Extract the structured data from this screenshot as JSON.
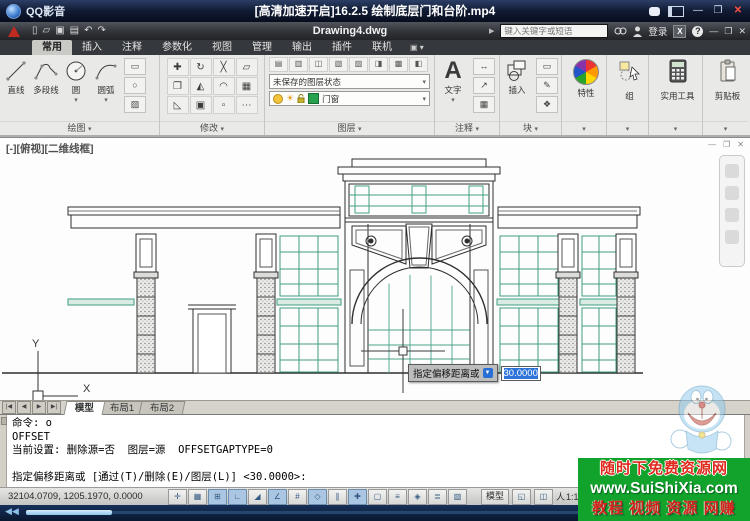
{
  "player": {
    "app_name": "QQ影音",
    "video_title": "[高清加速开启]16.2.5  绘制底层门和台阶.mp4"
  },
  "titlebar": {
    "doc_title": "Drawing4.dwg",
    "search_placeholder": "键入关键字或短语",
    "signin_label": "登录",
    "help_label": "?",
    "exchange_label": "X"
  },
  "window_controls": {
    "minimize": "—",
    "maximize": "❐",
    "close": "✕"
  },
  "ribbon": {
    "tabs": [
      "常用",
      "插入",
      "注释",
      "参数化",
      "视图",
      "管理",
      "输出",
      "插件",
      "联机"
    ],
    "active_tab": "常用",
    "draw": {
      "label": "绘图",
      "tools": [
        "直线",
        "多段线",
        "圆",
        "圆弧"
      ]
    },
    "modify": {
      "label": "修改"
    },
    "layers": {
      "label": "图层",
      "state": "未保存的图层状态",
      "current": "门窗",
      "color": "#28a14e"
    },
    "annotate": {
      "label": "注释",
      "text": "文字"
    },
    "block": {
      "label": "块",
      "insert": "插入"
    },
    "properties": {
      "label": "特性"
    },
    "group": {
      "label": "组"
    },
    "utilities": {
      "label": "实用工具"
    },
    "clipboard": {
      "label": "剪贴板"
    }
  },
  "viewport": {
    "label": "[-][俯视][二维线框]",
    "ucs_x": "X",
    "ucs_y": "Y",
    "tooltip_prompt": "指定偏移距离或",
    "tooltip_value": "30.0000"
  },
  "layout": {
    "tabs": [
      "模型",
      "布局1",
      "布局2"
    ],
    "active": "模型"
  },
  "command": {
    "lines": [
      "命令: o",
      "OFFSET",
      "当前设置: 删除源=否  图层=源  OFFSETGAPTYPE=0",
      "",
      "指定偏移距离或 [通过(T)/删除(E)/图层(L)] <30.0000>:"
    ]
  },
  "statusbar": {
    "coords": "32104.0709, 1205.1970, 0.0000",
    "model_label": "模型",
    "scale_icon": "人",
    "scale_label": "1:1"
  },
  "watermark": {
    "line1": "随时下免费资源网",
    "line2": "www.SuiShiXia.com",
    "line3": "教程 视频 资源 网赚"
  },
  "icons": {
    "chevron": "▾",
    "arrow_right": "▶",
    "sun": "☀",
    "qat": [
      {
        "name": "new-file-icon",
        "glyph": "▯"
      },
      {
        "name": "open-file-icon",
        "glyph": "▱"
      },
      {
        "name": "save-icon",
        "glyph": "▣"
      },
      {
        "name": "plot-icon",
        "glyph": "▤"
      },
      {
        "name": "undo-icon",
        "glyph": "↶"
      },
      {
        "name": "redo-icon",
        "glyph": "↷"
      }
    ],
    "draw_minis": [
      {
        "name": "rectangle-icon",
        "glyph": "▭"
      },
      {
        "name": "ellipse-icon",
        "glyph": "○"
      },
      {
        "name": "hatch-icon",
        "glyph": "▨"
      }
    ],
    "modify": [
      {
        "name": "move-icon",
        "glyph": "✚"
      },
      {
        "name": "rotate-icon",
        "glyph": "↻"
      },
      {
        "name": "trim-icon",
        "glyph": "╳"
      },
      {
        "name": "erase-icon",
        "glyph": "▱"
      },
      {
        "name": "copy-icon",
        "glyph": "❐"
      },
      {
        "name": "mirror-icon",
        "glyph": "◭"
      },
      {
        "name": "fillet-icon",
        "glyph": "◠"
      },
      {
        "name": "array-icon",
        "glyph": "▦"
      },
      {
        "name": "stretch-icon",
        "glyph": "◺"
      },
      {
        "name": "scale-icon",
        "glyph": "▣"
      },
      {
        "name": "explode-icon",
        "glyph": "▫"
      },
      {
        "name": "more-modify-icon",
        "glyph": "⋯"
      }
    ],
    "layer_tools": [
      {
        "name": "layer-properties-icon",
        "glyph": "▤"
      },
      {
        "name": "layer-off-icon",
        "glyph": "▥"
      },
      {
        "name": "layer-isolate-icon",
        "glyph": "◫"
      },
      {
        "name": "layer-freeze-icon",
        "glyph": "▧"
      },
      {
        "name": "layer-lock-icon",
        "glyph": "▨"
      },
      {
        "name": "layer-match-icon",
        "glyph": "◨"
      },
      {
        "name": "layer-prev-icon",
        "glyph": "▩"
      },
      {
        "name": "layer-walk-icon",
        "glyph": "◧"
      }
    ],
    "annotate_minis": [
      {
        "name": "dimension-icon",
        "glyph": "↔"
      },
      {
        "name": "leader-icon",
        "glyph": "↗"
      },
      {
        "name": "table-icon",
        "glyph": "▦"
      }
    ],
    "block_minis": [
      {
        "name": "block-edit-icon",
        "glyph": "▭"
      },
      {
        "name": "block-create-icon",
        "glyph": "✎"
      },
      {
        "name": "block-attr-icon",
        "glyph": "❖"
      }
    ],
    "status_toggles": [
      {
        "name": "infer-toggle",
        "glyph": "✛"
      },
      {
        "name": "snap-toggle",
        "glyph": "▦"
      },
      {
        "name": "grid-toggle",
        "glyph": "⊞"
      },
      {
        "name": "ortho-toggle",
        "glyph": "∟"
      },
      {
        "name": "polar-toggle",
        "glyph": "◢"
      },
      {
        "name": "osnap-toggle",
        "glyph": "∠"
      },
      {
        "name": "osnap3d-toggle",
        "glyph": "#"
      },
      {
        "name": "otrack-toggle",
        "glyph": "◇"
      },
      {
        "name": "ducs-toggle",
        "glyph": "∥"
      },
      {
        "name": "dyn-toggle",
        "glyph": "✚"
      },
      {
        "name": "lwt-toggle",
        "glyph": "▢"
      },
      {
        "name": "transparency-toggle",
        "glyph": "≡"
      },
      {
        "name": "quickprop-toggle",
        "glyph": "◈"
      },
      {
        "name": "cycling-toggle",
        "glyph": "≣"
      },
      {
        "name": "annot-toggle",
        "glyph": "▧"
      }
    ]
  }
}
